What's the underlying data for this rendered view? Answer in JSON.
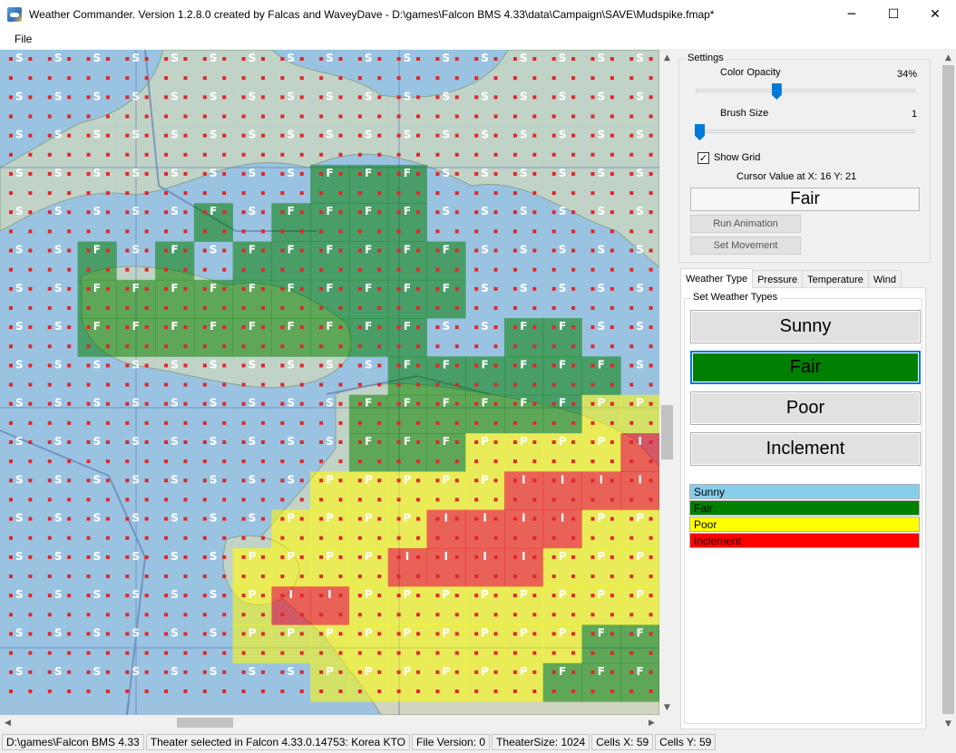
{
  "window": {
    "title": "Weather Commander. Version 1.2.8.0 created by Falcas and WaveyDave - D:\\games\\Falcon BMS 4.33\\data\\Campaign\\SAVE\\Mudspike.fmap*",
    "minimize_glyph": "─",
    "maximize_glyph": "☐",
    "close_glyph": "✕"
  },
  "menu": {
    "file": "File"
  },
  "map": {
    "labels": {
      "sunny": "S",
      "fair": "F",
      "poor": "P",
      "inclement": "I"
    },
    "colors": {
      "sunny": "#87ceeb",
      "fair": "#008000",
      "poor": "#ffff00",
      "inclement": "#ff0000",
      "grid_dot": "#e0262a",
      "sea": "#9fc1e1",
      "land": "#cfd5c0"
    },
    "grid_cols": 17,
    "grid_rows": 17,
    "rows": [
      "SSSSSSSSSSSSSSSSS",
      "SSSSSSSSSSSSSSSSS",
      "SSSSSSSSSSSSSSSSS",
      "SSSSSSSSFFFSSSSSS",
      "SSSSSFSFFFFSSSSSS",
      "SSFSFSFFFFFFSSSSS",
      "SSFFFFFFFFFFSSSSS",
      "SSFFFFFFFFFSSFFSS",
      "SSSSSSSSSSFFFFFFS",
      "SSSSSSSSSFFFFFFPP",
      "SSSSSSSSSFFFPPPPI",
      "SSSSSSSSPPPPPIIII",
      "SSSSSSSPPPPIIIIPP",
      "SSSSSSPPPPIIIIPPP",
      "SSSSSSPIIPPPPPPPP",
      "SSSSSSPPPPPPPPPFF",
      "SSSSSSSSPPPPPPFFF"
    ]
  },
  "settings": {
    "legend": "Settings",
    "opacity_label": "Color Opacity",
    "opacity_value_text": "34%",
    "opacity_value": 0.34,
    "brush_label": "Brush Size",
    "brush_value_text": "1",
    "brush_value": 0.0,
    "show_grid_label": "Show Grid",
    "show_grid_check": "✓",
    "cursor_label": "Cursor Value at X: 16 Y: 21",
    "cursor_value": "Fair",
    "run_animation": "Run Animation",
    "set_movement": "Set Movement"
  },
  "tabs": [
    "Weather Type",
    "Pressure",
    "Temperature",
    "Wind"
  ],
  "weather_types": {
    "legend": "Set Weather Types",
    "buttons": [
      "Sunny",
      "Fair",
      "Poor",
      "Inclement"
    ],
    "selected": "Fair",
    "color_legend": [
      {
        "label": "Sunny",
        "color": "#87ceeb"
      },
      {
        "label": "Fair",
        "color": "#008000"
      },
      {
        "label": "Poor",
        "color": "#ffff00"
      },
      {
        "label": "Inclement",
        "color": "#ff0000"
      }
    ]
  },
  "status": {
    "path": "D:\\games\\Falcon BMS 4.33",
    "theater": "Theater selected in Falcon 4.33.0.14753: Korea KTO",
    "file_version": "File Version: 0",
    "theater_size": "TheaterSize: 1024",
    "cells_x": "Cells X: 59",
    "cells_y": "Cells Y: 59"
  }
}
